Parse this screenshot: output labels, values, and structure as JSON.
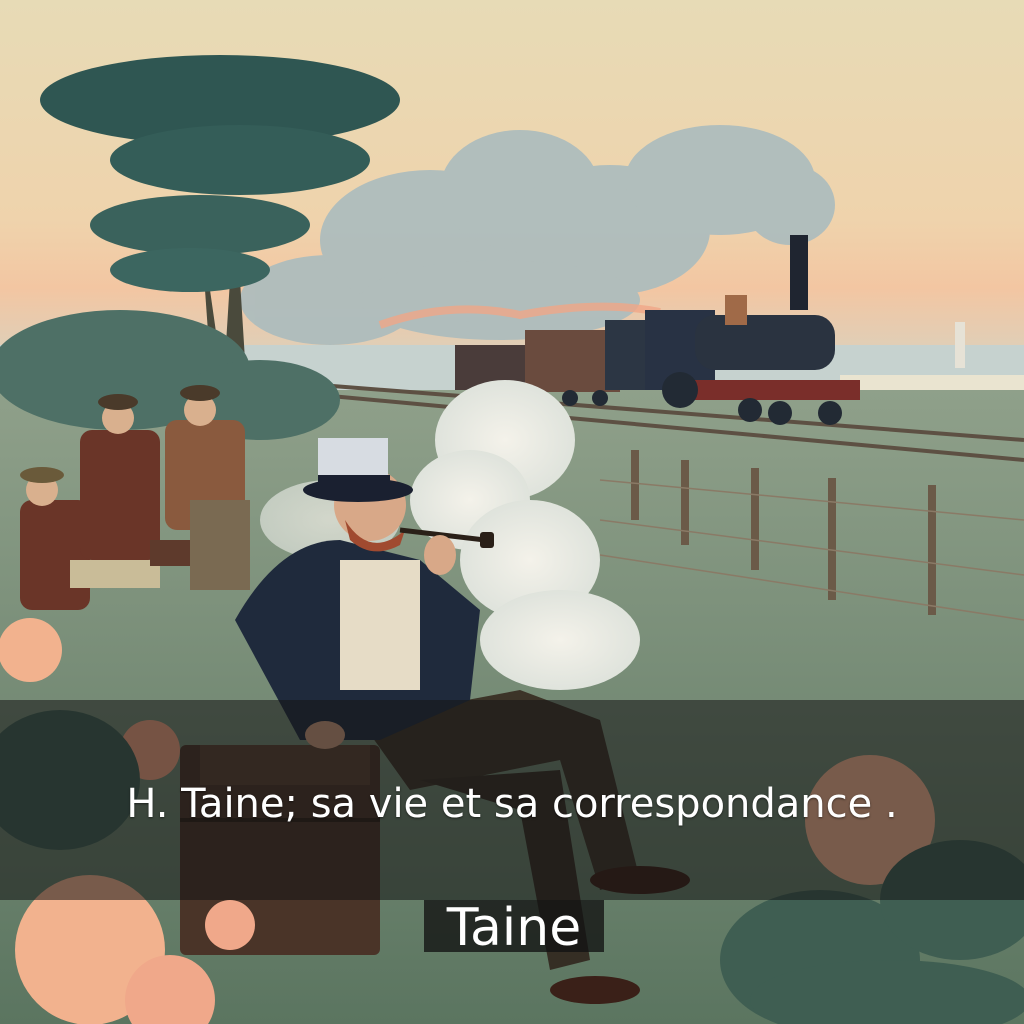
{
  "cover": {
    "title": "H. Taine; sa vie et sa correspondance .",
    "author": "Taine"
  },
  "illustration": {
    "subject": "man in top hat smoking a pipe seated on a trunk beside a railway, with steam locomotive and three men on a bench",
    "colors": {
      "sky_top": "#e8dcb6",
      "sky_glow": "#f2c7a0",
      "grass": "#6f8a6a",
      "foliage": "#3f5e52",
      "steam": "#b9c6c4",
      "locomotive": "#2a3340",
      "coat": "#1f2a3c",
      "flower": "#f2b28e"
    }
  }
}
